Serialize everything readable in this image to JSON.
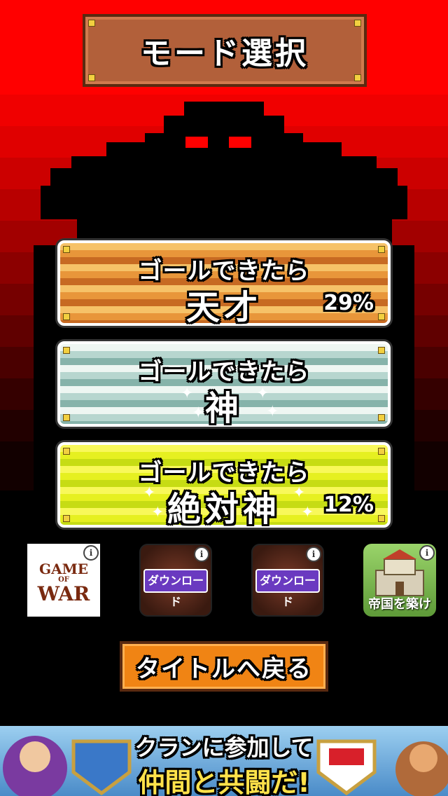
{
  "title": "モード選択",
  "modes": [
    {
      "line1": "ゴールできたら",
      "line2": "天才",
      "percent": "29%"
    },
    {
      "line1": "ゴールできたら",
      "line2": "神",
      "percent": ""
    },
    {
      "line1": "ゴールできたら",
      "line2": "絶対神",
      "percent": "12%"
    }
  ],
  "ads": [
    {
      "icon": "game-of-war-icon",
      "line1": "GAME",
      "line2": "OF",
      "line3": "WAR"
    },
    {
      "icon": "download-ad-icon",
      "label": "ダウンロード"
    },
    {
      "icon": "download-ad-icon",
      "label": "ダウンロード"
    },
    {
      "icon": "castle-game-icon",
      "label": "帝国を築け"
    }
  ],
  "info_glyph": "i",
  "back_button": "タイトルへ戻る",
  "banner": {
    "line1": "クランに参加して",
    "line2": "仲間と共闘だ!"
  },
  "colors": {
    "background_top": "#ff0000",
    "background_bottom": "#000000",
    "back_button": "#f08414"
  }
}
